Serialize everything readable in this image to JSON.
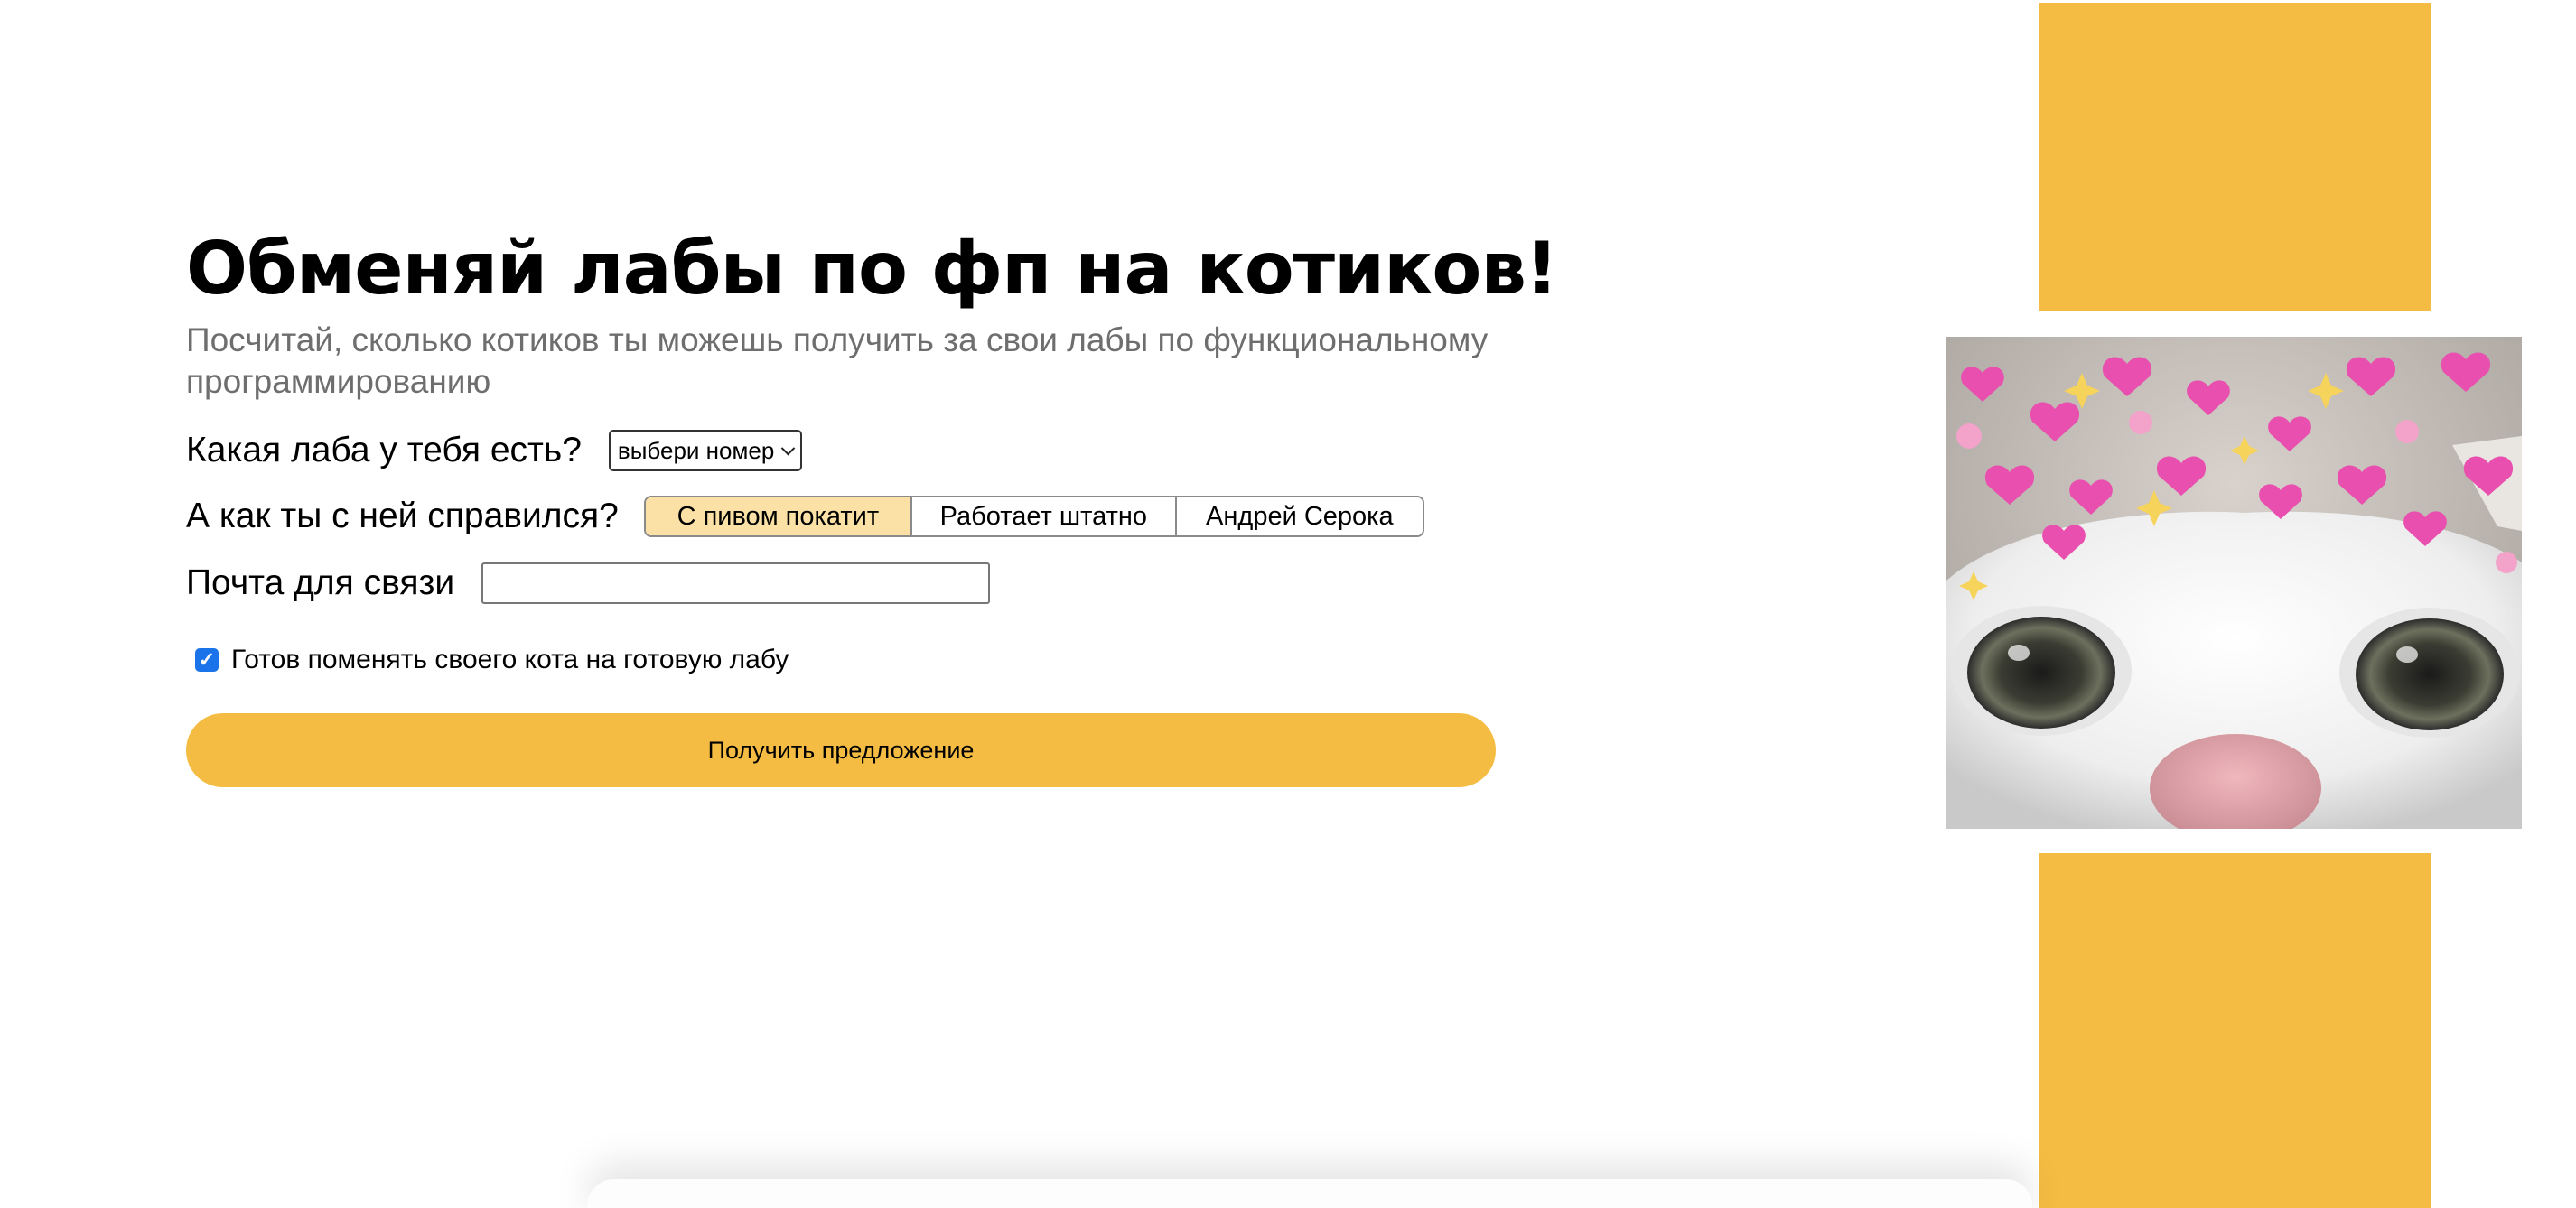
{
  "header": {
    "title": "Обменяй лабы по фп на котиков!",
    "subtitle": "Посчитай, сколько котиков ты можешь получить за свои лабы по функциональному программированию"
  },
  "form": {
    "lab_label": "Какая лаба у тебя есть?",
    "lab_select_value": "выбери номер",
    "done_label": "А как ты с ней справился?",
    "done_options": [
      "С пивом покатит",
      "Работает штатно",
      "Андрей Серока"
    ],
    "done_selected_index": 0,
    "email_label": "Почта для связи",
    "email_value": "",
    "email_placeholder": "",
    "agree_label": "Готов поменять своего кота на готовую лабу",
    "agree_checked": true,
    "submit_label": "Получить предложение"
  },
  "colors": {
    "accent": "#f4bc42",
    "accent_light": "#fbe1a6",
    "subtitle": "#6e6e6e",
    "checkbox": "#1a73e8"
  }
}
